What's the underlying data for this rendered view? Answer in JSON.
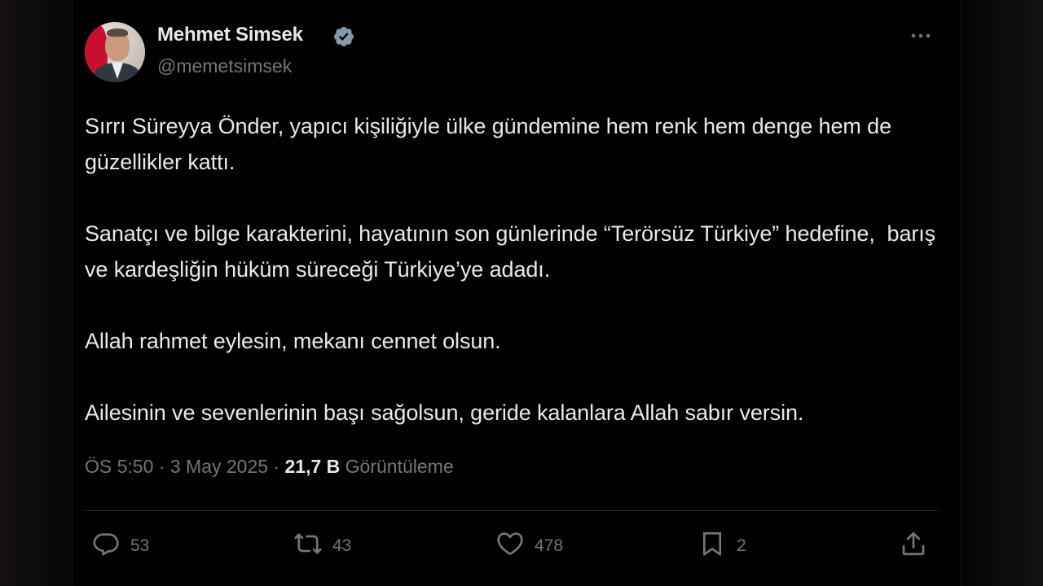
{
  "author": {
    "display_name": "Mehmet Simsek",
    "handle": "@memetsimsek",
    "verified": true
  },
  "tweet": {
    "paragraphs": [
      "Sırrı Süreyya Önder, yapıcı kişiliğiyle ülke gündemine hem renk hem denge hem de güzellikler kattı.",
      "Sanatçı ve bilge karakterini, hayatının son günlerinde “Terörsüz Türkiye” hedefine,  barış ve kardeşliğin hüküm süreceği Türkiye’ye adadı.",
      "Allah rahmet eylesin, mekanı cennet olsun.",
      "Ailesinin ve sevenlerinin başı sağolsun, geride kalanlara Allah sabır versin."
    ]
  },
  "meta": {
    "time": "ÖS 5:50",
    "separator1": " · ",
    "date": "3 May 2025",
    "separator2": " · ",
    "views_count": "21,7 B",
    "views_label": " Görüntüleme"
  },
  "actions": {
    "replies": "53",
    "reposts": "43",
    "likes": "478",
    "bookmarks": "2"
  },
  "icons": {
    "verified": "verified-badge-icon",
    "more": "more-options-icon",
    "reply": "reply-icon",
    "repost": "repost-icon",
    "like": "heart-icon",
    "bookmark": "bookmark-icon",
    "share": "share-icon"
  },
  "colors": {
    "background": "#000000",
    "text_primary": "#e7e9ea",
    "text_secondary": "#71767b",
    "divider": "#2f3336",
    "verified_badge": "#829aab"
  }
}
